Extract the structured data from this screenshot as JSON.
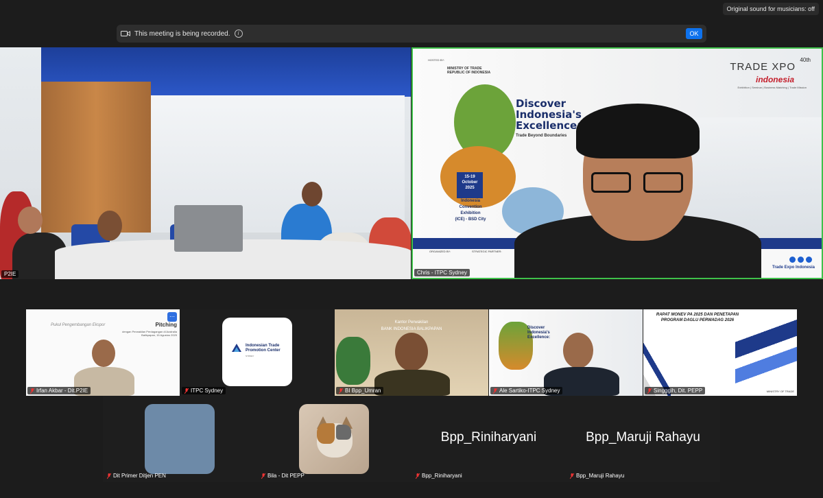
{
  "top_right": {
    "sound_label": "Original sound for musicians: off"
  },
  "banner": {
    "text": "This meeting is being recorded.",
    "ok_label": "OK"
  },
  "main_tiles": [
    {
      "name": "P2IE"
    },
    {
      "name": "Chris - ITPC Sydney"
    }
  ],
  "slide": {
    "hosted_by": "HOSTED BY:",
    "ministry": "MINISTRY OF TRADE\nREPUBLIC OF INDONESIA",
    "trade_expo": "TRADE XPO",
    "edition": "40th",
    "indonesia": "indonesia",
    "trade_sub": "Exhibition | Seminar | Business Matching | Trade Mission",
    "headline": "Discover\nIndonesia's\nExcellence:",
    "tagline": "Trade Beyond Boundaries",
    "dates": "15-19\nOctober\n2025",
    "venue": "Indonesia\nConvention\nExhibition\n(ICE) - BSD City",
    "organized_by": "ORGANIZED BY:",
    "strategic_partner": "STRATEGIC PARTNER:",
    "social_handle": "Trade Expo Indonesia"
  },
  "thumbnails": [
    {
      "name": "Irfan Akbar - Dit.P2IE",
      "pitch_script": "Pukul Pengembangan Ekspor",
      "pitch_title": "Pitching",
      "pitch_sub": "dengan Perwakilan Perdagangan di Australia\nBalikpapan, 15 Agustus 2025"
    },
    {
      "name": "ITPC Sydney",
      "logo_text": "Indonesian Trade\nPromotion Center",
      "logo_sub": "SYDNEY"
    },
    {
      "name": "BI Bpp_Umran",
      "bg_title": "Kantor Perwakilan\nBANK INDONESIA BALIKPAPAN"
    },
    {
      "name": "Ale Sartiko-ITPC Sydney"
    },
    {
      "name": "Singggih, Dit. PEPP",
      "slide_title": "RAPAT MONEV PA 2025 DAN PENETAPAN PROGRAM DAGLU PERWADAG 2026",
      "ministry": "MINISTRY OF TRADE"
    }
  ],
  "grid": [
    {
      "name": "Dit Primer Ditjen PEN"
    },
    {
      "name": "Bila - Dit PEPP"
    },
    {
      "name": "Bpp_Riniharyani",
      "display": "Bpp_Riniharyani"
    },
    {
      "name": "Bpp_Maruji Rahayu",
      "display": "Bpp_Maruji Rahayu"
    }
  ]
}
